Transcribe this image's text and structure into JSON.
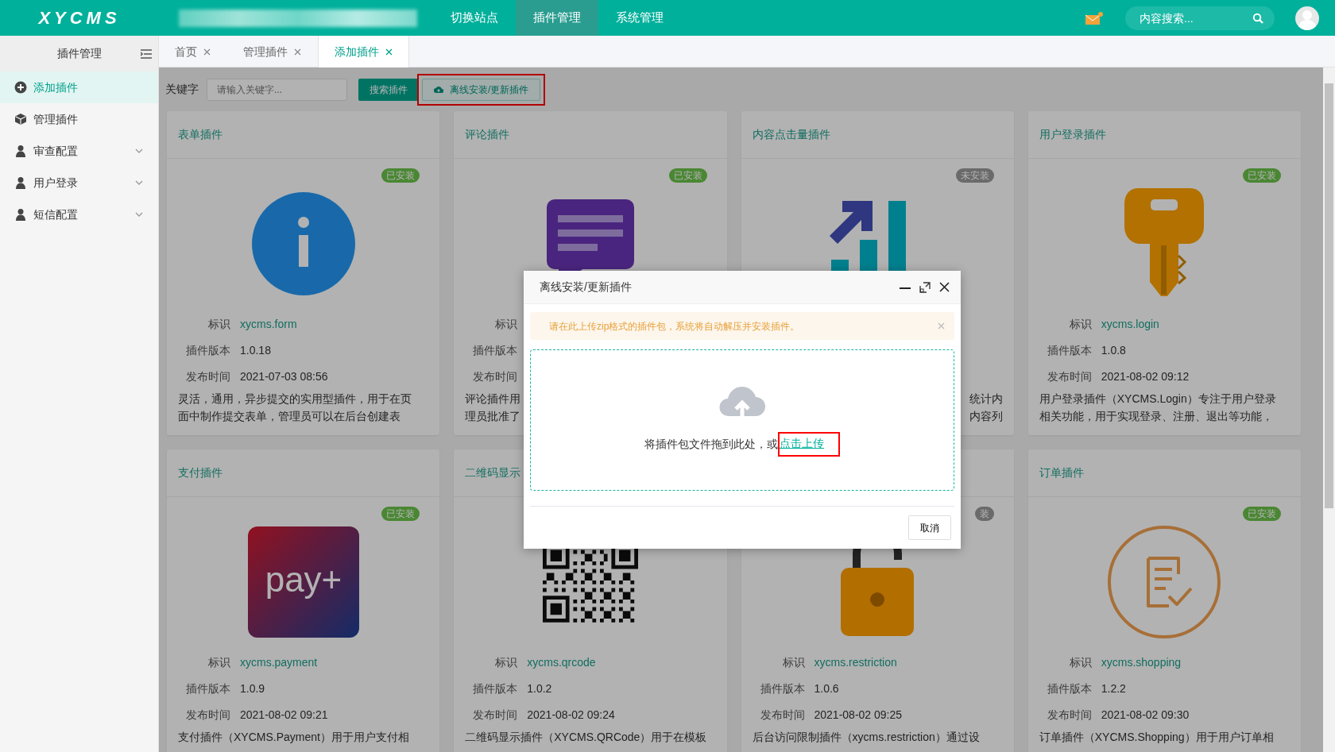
{
  "header": {
    "logo": "XYCMS",
    "nav": [
      {
        "label": "切换站点",
        "selected": false
      },
      {
        "label": "插件管理",
        "selected": true
      },
      {
        "label": "系统管理",
        "selected": false
      }
    ],
    "search": {
      "placeholder": "内容搜索..."
    }
  },
  "sidebar": {
    "title": "插件管理",
    "items": [
      {
        "label": "添加插件",
        "selected": true
      },
      {
        "label": "管理插件",
        "selected": false
      },
      {
        "label": "审查配置",
        "selected": false,
        "expanded": false
      },
      {
        "label": "用户登录",
        "selected": false,
        "expanded": false
      },
      {
        "label": "短信配置",
        "selected": false,
        "expanded": false
      }
    ]
  },
  "tabs": [
    {
      "label": "首页",
      "selected": false
    },
    {
      "label": "管理插件",
      "selected": false
    },
    {
      "label": "添加插件",
      "selected": true
    }
  ],
  "toolbar": {
    "keyword_label": "关键字",
    "keyword": {
      "placeholder": "请输入关键字..."
    },
    "buttons": [
      {
        "label": "搜索插件",
        "kind": "primary"
      },
      {
        "label": "离线安装/更新插件",
        "kind": "upload"
      }
    ]
  },
  "plugins": [
    {
      "title": "表单插件",
      "installed": true,
      "status": "已安装",
      "meta": [
        {
          "label": "标识",
          "value": "xycms.form"
        },
        {
          "label": "插件版本",
          "value": "1.0.18"
        },
        {
          "label": "发布时间",
          "value": "2021-07-03 08:56"
        }
      ],
      "description": [
        "灵活，通用，异步提交的实用型插件，用于在页",
        "面中制作提交表单，管理员可以在后台创建表"
      ]
    },
    {
      "title": "评论插件",
      "installed": true,
      "status": "已安装",
      "meta": [
        {
          "label": "标识"
        },
        {
          "label": "插件版本"
        },
        {
          "label": "发布时间"
        }
      ],
      "description": [
        "评论插件用",
        "理员批准了"
      ]
    },
    {
      "title": "内容点击量插件",
      "installed": false,
      "status": "未安装",
      "description": [
        "统计内",
        "内容列"
      ]
    },
    {
      "title": "用户登录插件",
      "installed": true,
      "status": "已安装",
      "meta": [
        {
          "label": "标识",
          "value": "xycms.login"
        },
        {
          "label": "插件版本",
          "value": "1.0.8"
        },
        {
          "label": "发布时间",
          "value": "2021-08-02 09:12"
        }
      ],
      "description": [
        "用户登录插件（XYCMS.Login）专注于用户登录",
        "相关功能，用于实现登录、注册、退出等功能，"
      ]
    },
    {
      "title": "支付插件",
      "installed": true,
      "status": "已安装",
      "logo_text": "pay+",
      "meta": [
        {
          "label": "标识",
          "value": "xycms.payment"
        },
        {
          "label": "插件版本",
          "value": "1.0.9"
        },
        {
          "label": "发布时间",
          "value": "2021-08-02 09:21"
        }
      ],
      "description": [
        "支付插件（XYCMS.Payment）用于用户支付相"
      ]
    },
    {
      "title": "二维码显示",
      "meta": [
        {
          "label": "标识",
          "value": "xycms.qrcode"
        },
        {
          "label": "插件版本",
          "value": "1.0.2"
        },
        {
          "label": "发布时间",
          "value": "2021-08-02 09:24"
        }
      ],
      "description": [
        "二维码显示插件（XYCMS.QRCode）用于在模板"
      ]
    },
    {
      "installed": false,
      "status": "装",
      "meta": [
        {
          "label": "标识",
          "value": "xycms.restriction"
        },
        {
          "label": "插件版本",
          "value": "1.0.6"
        },
        {
          "label": "发布时间",
          "value": "2021-08-02 09:25"
        }
      ],
      "description": [
        "后台访问限制插件（xycms.restriction）通过设"
      ]
    },
    {
      "title": "订单插件",
      "installed": true,
      "status": "已安装",
      "meta": [
        {
          "label": "标识",
          "value": "xycms.shopping"
        },
        {
          "label": "插件版本",
          "value": "1.2.2"
        },
        {
          "label": "发布时间",
          "value": "2021-08-02 09:30"
        }
      ],
      "description": [
        "订单插件（XYCMS.Shopping）用于用户订单相"
      ]
    }
  ],
  "dialog": {
    "title": "离线安装/更新插件",
    "alert": "请在此上传zip格式的插件包，系统将自动解压并安装插件。",
    "drop_text": "将插件包文件拖到此处，或",
    "upload_link": "点击上传",
    "cancel": "取消"
  }
}
